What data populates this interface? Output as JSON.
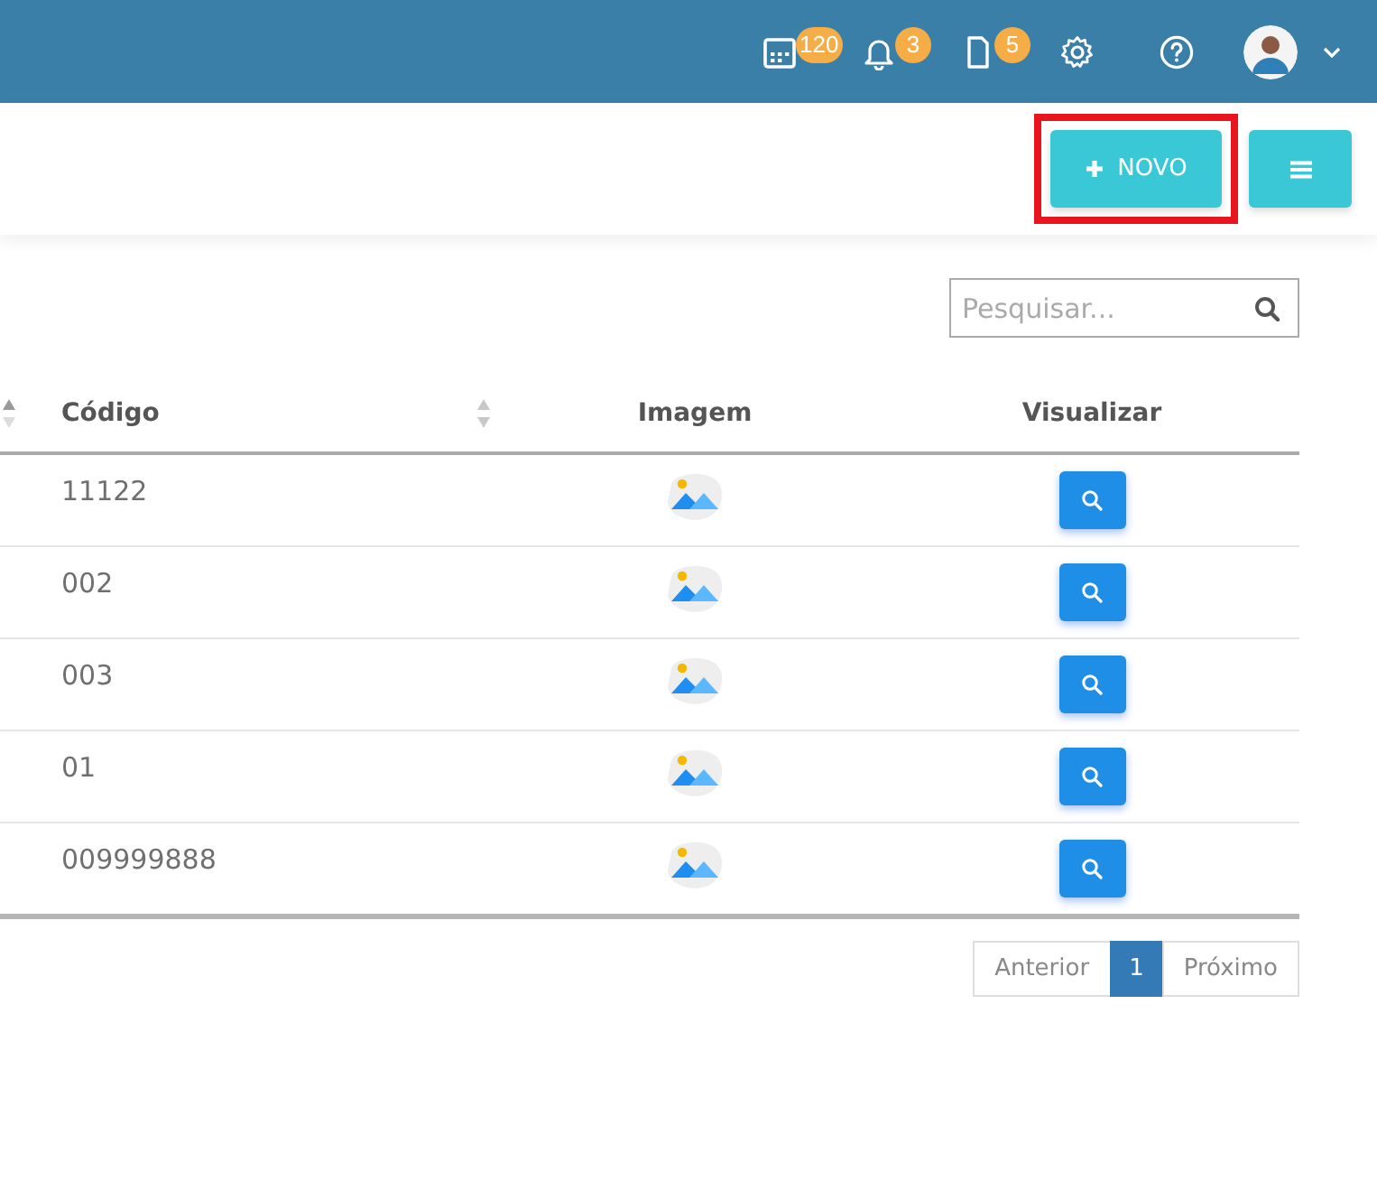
{
  "header": {
    "badges": [
      {
        "kind": "calendar",
        "count": "120"
      },
      {
        "kind": "bell",
        "count": "3"
      },
      {
        "kind": "document",
        "count": "5"
      }
    ],
    "icons": [
      {
        "kind": "settings"
      },
      {
        "kind": "help"
      }
    ]
  },
  "toolbar": {
    "new_button": {
      "label": "NOVO",
      "highlighted": true
    },
    "menu_button": {
      "kind": "menu"
    }
  },
  "search": {
    "placeholder": "Pesquisar..."
  },
  "table": {
    "columns": [
      {
        "sortable": true
      },
      {
        "label": "Código",
        "sortable": true
      },
      {
        "label": "Imagem",
        "sortable": false
      },
      {
        "label": "Visualizar",
        "sortable": false
      }
    ],
    "rows": [
      {
        "code": "11122"
      },
      {
        "code": "002"
      },
      {
        "code": "003"
      },
      {
        "code": "01"
      },
      {
        "code": "009999888"
      }
    ]
  },
  "pagination": [
    {
      "label": "Anterior",
      "selected": false
    },
    {
      "label": "1",
      "selected": true
    },
    {
      "label": "Próximo",
      "selected": false
    }
  ]
}
